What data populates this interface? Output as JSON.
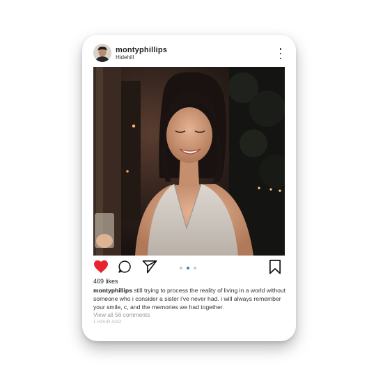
{
  "post": {
    "username": "montyphillips",
    "location": "Hidehill",
    "likes": "469 likes",
    "caption_user": "montyphillips",
    "caption_text": " still trying to process the reality of living in a world without someone who i consider a sister i've never had. i will always remember your smile, c, and the memories we had together.",
    "comments": "View all 56 comments",
    "time": "1 HOUR AGO"
  },
  "icons": {
    "like": "heart-icon",
    "comment": "comment-bubble-icon",
    "share": "paper-plane-icon",
    "save": "bookmark-icon",
    "menu": "more-vertical-icon"
  },
  "carousel": {
    "count": 3,
    "active": 2
  },
  "colors": {
    "like": "#e8252e",
    "active_dot": "#3b82c4",
    "inactive_dot": "#c9c9c9"
  }
}
